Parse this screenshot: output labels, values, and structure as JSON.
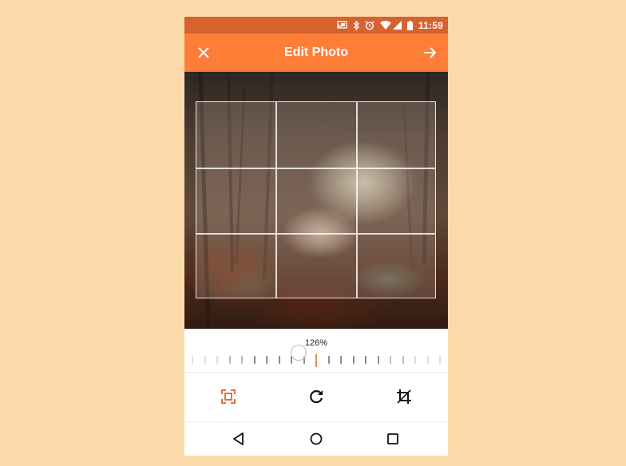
{
  "status_bar": {
    "time": "11:59",
    "icons": [
      "cast-icon",
      "bluetooth-icon",
      "alarm-icon",
      "wifi-icon",
      "signal-icon",
      "battery-icon"
    ],
    "color": "#d6622f"
  },
  "app_bar": {
    "title": "Edit Photo",
    "close_icon": "close-icon",
    "next_icon": "arrow-right-icon",
    "color": "#fe7d37"
  },
  "editor": {
    "image_description": "Misty autumn forest path with orange leaves",
    "crop_grid": "rule-of-thirds"
  },
  "zoom_slider": {
    "value_label": "126%",
    "value_percent": 126,
    "accent_color": "#e0885a"
  },
  "tools": [
    {
      "name": "scale",
      "icon": "scale-icon",
      "active": true
    },
    {
      "name": "rotate",
      "icon": "rotate-icon",
      "active": false
    },
    {
      "name": "crop",
      "icon": "crop-icon",
      "active": false
    }
  ],
  "navigation": {
    "back": "back-icon",
    "home": "home-icon",
    "recents": "recents-icon"
  }
}
